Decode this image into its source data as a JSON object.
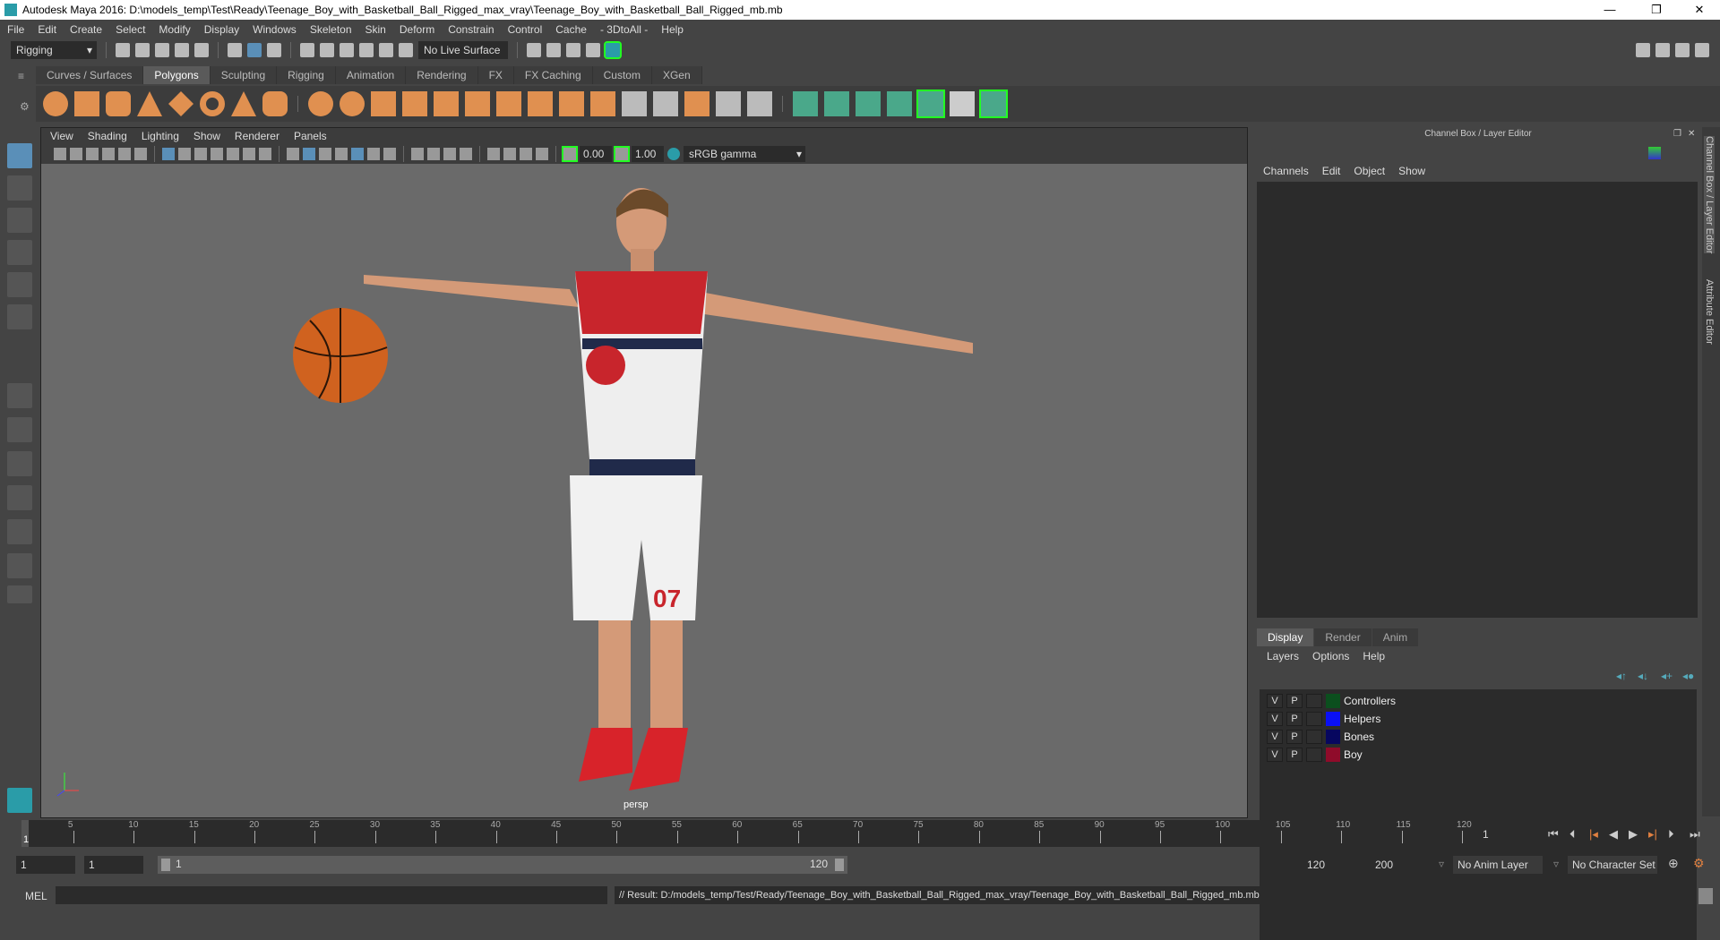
{
  "window": {
    "title": "Autodesk Maya 2016: D:\\models_temp\\Test\\Ready\\Teenage_Boy_with_Basketball_Ball_Rigged_max_vray\\Teenage_Boy_with_Basketball_Ball_Rigged_mb.mb",
    "minimize": "—",
    "restore": "❐",
    "close": "✕"
  },
  "menubar": [
    "File",
    "Edit",
    "Create",
    "Select",
    "Modify",
    "Display",
    "Windows",
    "Skeleton",
    "Skin",
    "Deform",
    "Constrain",
    "Control",
    "Cache",
    "- 3DtoAll -",
    "Help"
  ],
  "statusline": {
    "menuset": "Rigging",
    "live_surface": "No Live Surface"
  },
  "shelf": {
    "tabs": [
      "Curves / Surfaces",
      "Polygons",
      "Sculpting",
      "Rigging",
      "Animation",
      "Rendering",
      "FX",
      "FX Caching",
      "Custom",
      "XGen"
    ],
    "active": "Polygons"
  },
  "viewport": {
    "menu": [
      "View",
      "Shading",
      "Lighting",
      "Show",
      "Renderer",
      "Panels"
    ],
    "exposure": "0.00",
    "gamma": "1.00",
    "colorspace": "sRGB gamma",
    "camera_label": "persp"
  },
  "channelbox": {
    "title": "Channel Box / Layer Editor",
    "menu": [
      "Channels",
      "Edit",
      "Object",
      "Show"
    ]
  },
  "sidetabs": [
    "Channel Box / Layer Editor",
    "Attribute Editor"
  ],
  "layer_editor": {
    "tabs": [
      "Display",
      "Render",
      "Anim"
    ],
    "active": "Display",
    "menu": [
      "Layers",
      "Options",
      "Help"
    ],
    "layers": [
      {
        "v": "V",
        "p": "P",
        "name": "Controllers",
        "color": "#0b4f1e"
      },
      {
        "v": "V",
        "p": "P",
        "name": "Helpers",
        "color": "#0a10f5"
      },
      {
        "v": "V",
        "p": "P",
        "name": "Bones",
        "color": "#07075f"
      },
      {
        "v": "V",
        "p": "P",
        "name": "Boy",
        "color": "#8f0b2a"
      }
    ]
  },
  "timeline": {
    "start": 1,
    "end": 120,
    "current": "1",
    "labels": [
      5,
      10,
      15,
      20,
      25,
      30,
      35,
      40,
      45,
      50,
      55,
      60,
      65,
      70,
      75,
      80,
      85,
      90,
      95,
      100,
      105,
      110,
      115,
      120
    ],
    "current_field": "1"
  },
  "range": {
    "start": "1",
    "inner_start": "1",
    "slider_start": "1",
    "slider_end": "120",
    "end": "120",
    "max": "200",
    "anim_layer": "No Anim Layer",
    "character_set": "No Character Set"
  },
  "command": {
    "mode": "MEL",
    "result": "// Result: D:/models_temp/Test/Ready/Teenage_Boy_with_Basketball_Ball_Rigged_max_vray/Teenage_Boy_with_Basketball_Ball_Rigged_mb.mb"
  }
}
